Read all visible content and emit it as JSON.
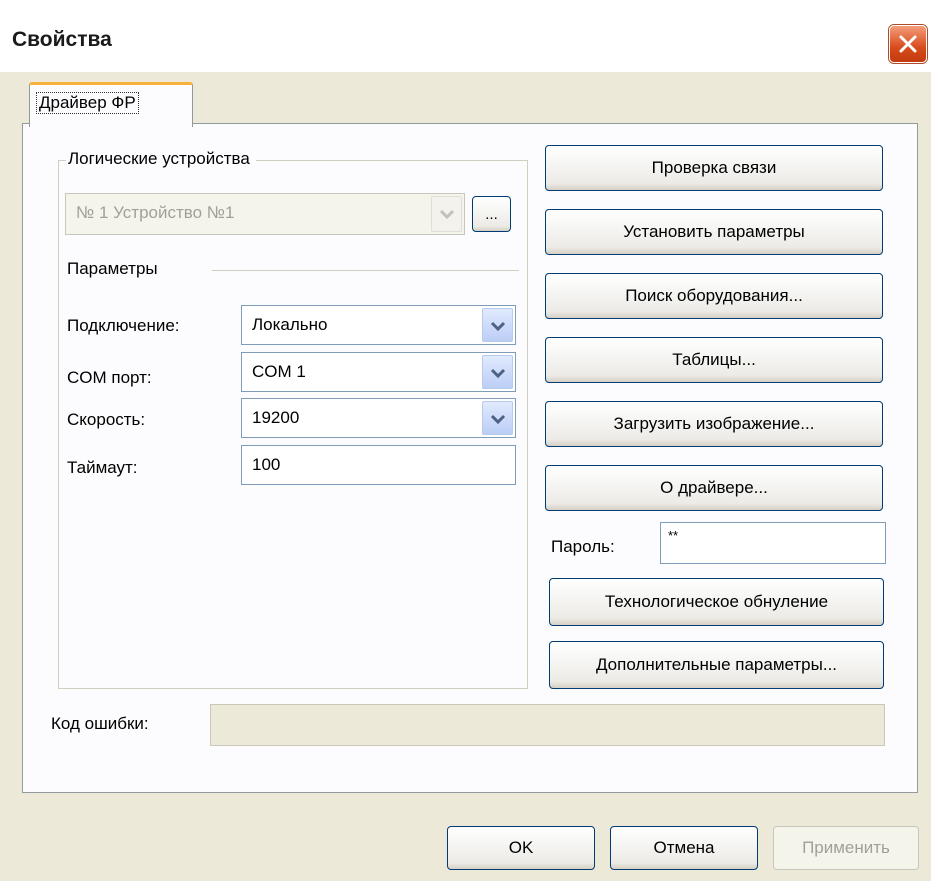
{
  "window": {
    "title": "Свойства"
  },
  "tabs": [
    {
      "label": "Драйвер ФР"
    }
  ],
  "logical_devices": {
    "group_label": "Логические устройства",
    "device_value": "№ 1 Устройство №1",
    "browse_label": "..."
  },
  "params": {
    "group_label": "Параметры",
    "connection_label": "Подключение:",
    "connection_value": "Локально",
    "com_label": "COM порт:",
    "com_value": "COM 1",
    "speed_label": "Скорость:",
    "speed_value": "19200",
    "timeout_label": "Таймаут:",
    "timeout_value": "100"
  },
  "actions": {
    "check_connection": "Проверка связи",
    "set_params": "Установить параметры",
    "search_hardware": "Поиск оборудования...",
    "tables": "Таблицы...",
    "load_image": "Загрузить изображение...",
    "about": "О драйвере...",
    "password_label": "Пароль:",
    "password_value": "**",
    "tech_reset": "Технологическое обнуление",
    "extra_params": "Дополнительные параметры..."
  },
  "error": {
    "label": "Код ошибки:",
    "value": ""
  },
  "footer": {
    "ok": "OK",
    "cancel": "Отмена",
    "apply": "Применить"
  },
  "colors": {
    "accent_tab": "#f6b03b",
    "button_border": "#003c74",
    "close": "#d84b1c"
  }
}
